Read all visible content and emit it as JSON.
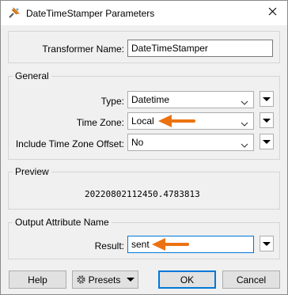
{
  "window": {
    "title": "DateTimeStamper Parameters",
    "close_icon": "close-icon",
    "app_icon": "fme-transformer-icon"
  },
  "transformer": {
    "label": "Transformer Name:",
    "value": "DateTimeStamper"
  },
  "general": {
    "title": "General",
    "type_label": "Type:",
    "type_value": "Datetime",
    "timezone_label": "Time Zone:",
    "timezone_value": "Local",
    "offset_label": "Include Time Zone Offset:",
    "offset_value": "No"
  },
  "preview": {
    "title": "Preview",
    "value": "20220802112450.4783813"
  },
  "output": {
    "title": "Output Attribute Name",
    "result_label": "Result:",
    "result_value": "sent"
  },
  "buttons": {
    "help": "Help",
    "presets": "Presets",
    "ok": "OK",
    "cancel": "Cancel"
  },
  "colors": {
    "annotation_arrow": "#ec7211",
    "accent": "#0078d7"
  }
}
